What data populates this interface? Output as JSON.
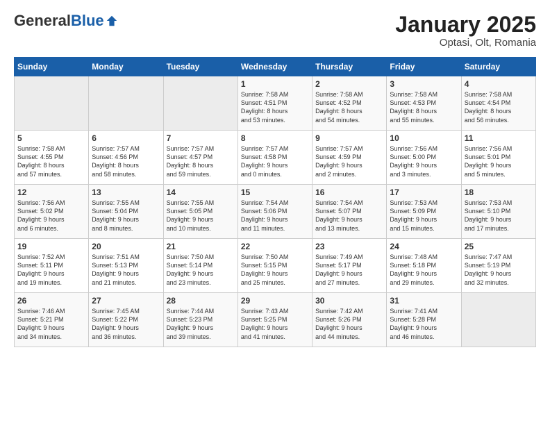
{
  "header": {
    "logo_general": "General",
    "logo_blue": "Blue",
    "title": "January 2025",
    "subtitle": "Optasi, Olt, Romania"
  },
  "weekdays": [
    "Sunday",
    "Monday",
    "Tuesday",
    "Wednesday",
    "Thursday",
    "Friday",
    "Saturday"
  ],
  "weeks": [
    [
      {
        "day": "",
        "info": ""
      },
      {
        "day": "",
        "info": ""
      },
      {
        "day": "",
        "info": ""
      },
      {
        "day": "1",
        "info": "Sunrise: 7:58 AM\nSunset: 4:51 PM\nDaylight: 8 hours\nand 53 minutes."
      },
      {
        "day": "2",
        "info": "Sunrise: 7:58 AM\nSunset: 4:52 PM\nDaylight: 8 hours\nand 54 minutes."
      },
      {
        "day": "3",
        "info": "Sunrise: 7:58 AM\nSunset: 4:53 PM\nDaylight: 8 hours\nand 55 minutes."
      },
      {
        "day": "4",
        "info": "Sunrise: 7:58 AM\nSunset: 4:54 PM\nDaylight: 8 hours\nand 56 minutes."
      }
    ],
    [
      {
        "day": "5",
        "info": "Sunrise: 7:58 AM\nSunset: 4:55 PM\nDaylight: 8 hours\nand 57 minutes."
      },
      {
        "day": "6",
        "info": "Sunrise: 7:57 AM\nSunset: 4:56 PM\nDaylight: 8 hours\nand 58 minutes."
      },
      {
        "day": "7",
        "info": "Sunrise: 7:57 AM\nSunset: 4:57 PM\nDaylight: 8 hours\nand 59 minutes."
      },
      {
        "day": "8",
        "info": "Sunrise: 7:57 AM\nSunset: 4:58 PM\nDaylight: 9 hours\nand 0 minutes."
      },
      {
        "day": "9",
        "info": "Sunrise: 7:57 AM\nSunset: 4:59 PM\nDaylight: 9 hours\nand 2 minutes."
      },
      {
        "day": "10",
        "info": "Sunrise: 7:56 AM\nSunset: 5:00 PM\nDaylight: 9 hours\nand 3 minutes."
      },
      {
        "day": "11",
        "info": "Sunrise: 7:56 AM\nSunset: 5:01 PM\nDaylight: 9 hours\nand 5 minutes."
      }
    ],
    [
      {
        "day": "12",
        "info": "Sunrise: 7:56 AM\nSunset: 5:02 PM\nDaylight: 9 hours\nand 6 minutes."
      },
      {
        "day": "13",
        "info": "Sunrise: 7:55 AM\nSunset: 5:04 PM\nDaylight: 9 hours\nand 8 minutes."
      },
      {
        "day": "14",
        "info": "Sunrise: 7:55 AM\nSunset: 5:05 PM\nDaylight: 9 hours\nand 10 minutes."
      },
      {
        "day": "15",
        "info": "Sunrise: 7:54 AM\nSunset: 5:06 PM\nDaylight: 9 hours\nand 11 minutes."
      },
      {
        "day": "16",
        "info": "Sunrise: 7:54 AM\nSunset: 5:07 PM\nDaylight: 9 hours\nand 13 minutes."
      },
      {
        "day": "17",
        "info": "Sunrise: 7:53 AM\nSunset: 5:09 PM\nDaylight: 9 hours\nand 15 minutes."
      },
      {
        "day": "18",
        "info": "Sunrise: 7:53 AM\nSunset: 5:10 PM\nDaylight: 9 hours\nand 17 minutes."
      }
    ],
    [
      {
        "day": "19",
        "info": "Sunrise: 7:52 AM\nSunset: 5:11 PM\nDaylight: 9 hours\nand 19 minutes."
      },
      {
        "day": "20",
        "info": "Sunrise: 7:51 AM\nSunset: 5:13 PM\nDaylight: 9 hours\nand 21 minutes."
      },
      {
        "day": "21",
        "info": "Sunrise: 7:50 AM\nSunset: 5:14 PM\nDaylight: 9 hours\nand 23 minutes."
      },
      {
        "day": "22",
        "info": "Sunrise: 7:50 AM\nSunset: 5:15 PM\nDaylight: 9 hours\nand 25 minutes."
      },
      {
        "day": "23",
        "info": "Sunrise: 7:49 AM\nSunset: 5:17 PM\nDaylight: 9 hours\nand 27 minutes."
      },
      {
        "day": "24",
        "info": "Sunrise: 7:48 AM\nSunset: 5:18 PM\nDaylight: 9 hours\nand 29 minutes."
      },
      {
        "day": "25",
        "info": "Sunrise: 7:47 AM\nSunset: 5:19 PM\nDaylight: 9 hours\nand 32 minutes."
      }
    ],
    [
      {
        "day": "26",
        "info": "Sunrise: 7:46 AM\nSunset: 5:21 PM\nDaylight: 9 hours\nand 34 minutes."
      },
      {
        "day": "27",
        "info": "Sunrise: 7:45 AM\nSunset: 5:22 PM\nDaylight: 9 hours\nand 36 minutes."
      },
      {
        "day": "28",
        "info": "Sunrise: 7:44 AM\nSunset: 5:23 PM\nDaylight: 9 hours\nand 39 minutes."
      },
      {
        "day": "29",
        "info": "Sunrise: 7:43 AM\nSunset: 5:25 PM\nDaylight: 9 hours\nand 41 minutes."
      },
      {
        "day": "30",
        "info": "Sunrise: 7:42 AM\nSunset: 5:26 PM\nDaylight: 9 hours\nand 44 minutes."
      },
      {
        "day": "31",
        "info": "Sunrise: 7:41 AM\nSunset: 5:28 PM\nDaylight: 9 hours\nand 46 minutes."
      },
      {
        "day": "",
        "info": ""
      }
    ]
  ]
}
